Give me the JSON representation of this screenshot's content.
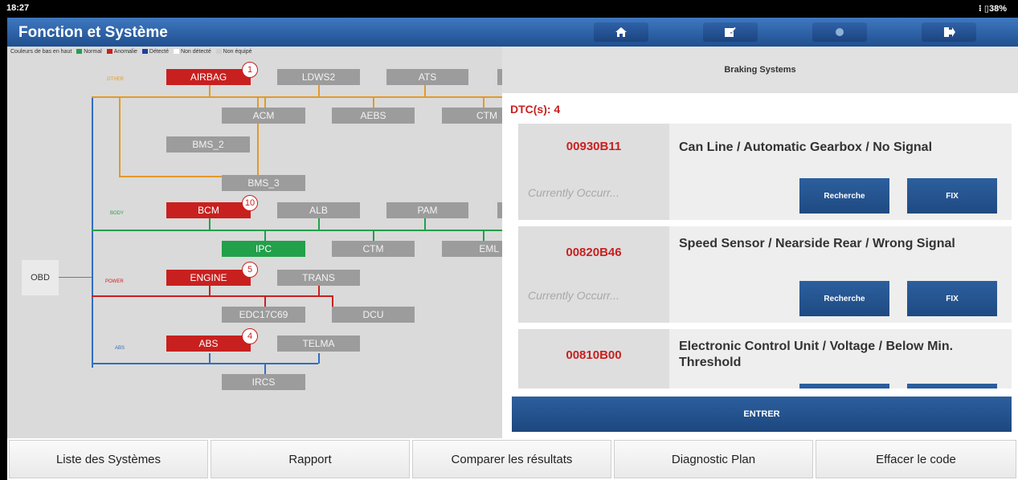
{
  "status_bar": {
    "time": "18:27",
    "right": "⁝ ▯38%"
  },
  "header": {
    "title": "Fonction et Système"
  },
  "header_buttons": [
    {
      "name": "home-icon",
      "glyph": "🏠"
    },
    {
      "name": "edit-icon",
      "glyph": "✎"
    },
    {
      "name": "print-icon",
      "glyph": "●"
    },
    {
      "name": "exit-icon",
      "glyph": "➜"
    }
  ],
  "legend": {
    "intro": "Couleurs de bas en haut",
    "items": [
      {
        "label": "Normal",
        "color": "#22a04a"
      },
      {
        "label": "Anomalie",
        "color": "#c8201f"
      },
      {
        "label": "Détecté",
        "color": "#1f3fa0"
      },
      {
        "label": "Non détecté",
        "color": "#ffffff"
      },
      {
        "label": "Non équipé",
        "color": "#cfcfcf"
      }
    ]
  },
  "topology": {
    "obd": "OBD",
    "groups": {
      "other": "OTHER",
      "body": "BODY",
      "power": "POWER",
      "abs": "ABS"
    },
    "nodes": {
      "airbag": "AIRBAG",
      "ldws2": "LDWS2",
      "ats": "ATS",
      "acm": "ACM",
      "aebs": "AEBS",
      "ctm_top": "CTM",
      "bms2": "BMS_2",
      "bms3": "BMS_3",
      "bcm": "BCM",
      "alb": "ALB",
      "pam": "PAM",
      "ipc": "IPC",
      "ctm": "CTM",
      "eml": "EML",
      "engine": "ENGINE",
      "trans": "TRANS",
      "edc": "EDC17C69",
      "dcu": "DCU",
      "abs": "ABS",
      "telma": "TELMA",
      "ircs": "IRCS"
    },
    "badges": {
      "airbag": "1",
      "bcm": "10",
      "engine": "5",
      "abs": "4"
    }
  },
  "panel": {
    "title": "Braking Systems",
    "dtc_count": "DTC(s): 4",
    "dtcs": [
      {
        "code": "00930B11",
        "status": "Currently Occurr...",
        "desc": "Can Line / Automatic Gearbox / No Signal",
        "btn1": "Recherche",
        "btn2": "FIX"
      },
      {
        "code": "00820B46",
        "status": "Currently Occurr...",
        "desc": "Speed Sensor  / Nearside Rear / Wrong Signal",
        "btn1": "Recherche",
        "btn2": "FIX"
      },
      {
        "code": "00810B00",
        "status": "",
        "desc": "Electronic Control Unit / Voltage / Below Min. Threshold",
        "btn1": "",
        "btn2": ""
      }
    ],
    "enter": "ENTRER"
  },
  "bottom_nav": [
    "Liste des Systèmes",
    "Rapport",
    "Comparer les résultats",
    "Diagnostic Plan",
    "Effacer le code"
  ]
}
